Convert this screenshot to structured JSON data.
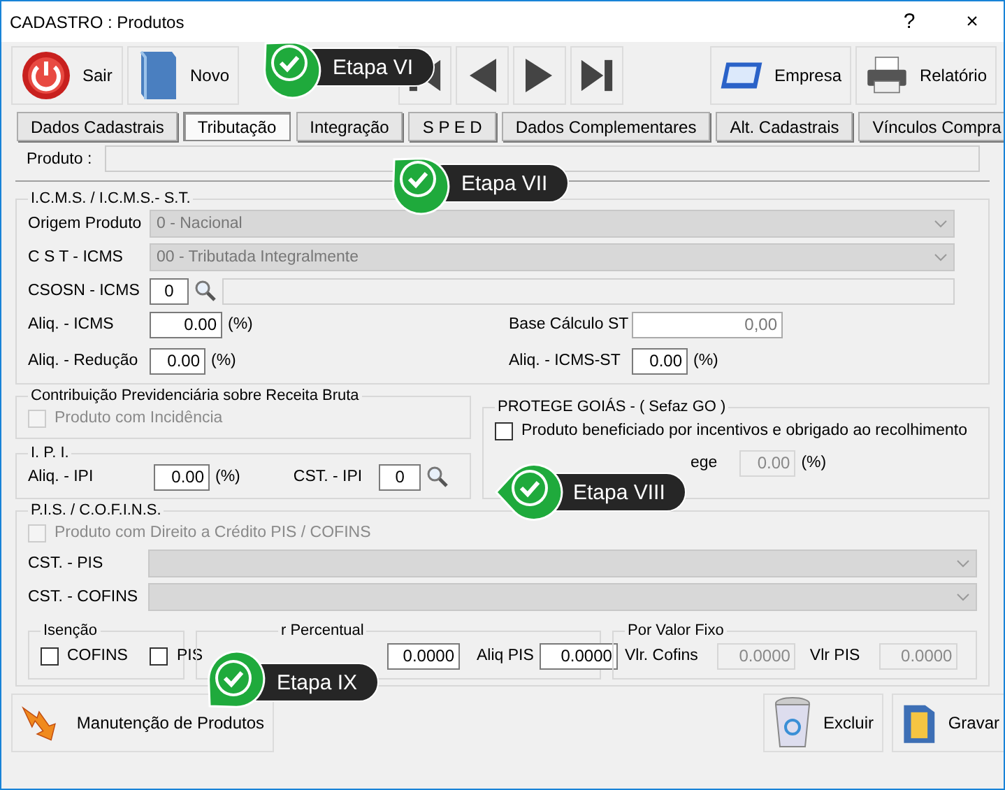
{
  "window": {
    "title": "CADASTRO : Produtos",
    "help": "?",
    "close": "×"
  },
  "toolbar": {
    "left": [
      {
        "kind": "exit",
        "label": "Sair"
      },
      {
        "kind": "new",
        "label": "Novo"
      }
    ],
    "nav": [
      {
        "kind": "first"
      },
      {
        "kind": "prev"
      },
      {
        "kind": "next"
      },
      {
        "kind": "last"
      }
    ],
    "right": [
      {
        "kind": "company",
        "label": "Empresa"
      },
      {
        "kind": "report",
        "label": "Relatório"
      }
    ]
  },
  "tabs": [
    {
      "label": "Dados Cadastrais",
      "selected": false
    },
    {
      "label": "Tributação",
      "selected": true
    },
    {
      "label": "Integração",
      "selected": false
    },
    {
      "label": "S P E D",
      "selected": false
    },
    {
      "label": "Dados Complementares",
      "selected": false
    },
    {
      "label": "Alt. Cadastrais",
      "selected": false
    },
    {
      "label": "Vínculos Compra",
      "selected": false
    }
  ],
  "produto": {
    "label": "Produto :"
  },
  "icms": {
    "title": "I.C.M.S. / I.C.M.S.- S.T.",
    "origem": {
      "label": "Origem Produto",
      "value": "0 - Nacional"
    },
    "cst": {
      "label": "C S T - ICMS",
      "value": "00 - Tributada Integralmente"
    },
    "csosn": {
      "label": "CSOSN - ICMS",
      "value": "0"
    },
    "aliq": {
      "label": "Aliq. - ICMS",
      "value": "0.00",
      "unit": "(%)"
    },
    "reducao": {
      "label": "Aliq. - Redução",
      "value": "0.00",
      "unit": "(%)"
    },
    "base_st": {
      "label": "Base Cálculo ST",
      "value": "0,00"
    },
    "aliq_st": {
      "label": "Aliq. - ICMS-ST",
      "value": "0.00",
      "unit": "(%)"
    }
  },
  "contribuicao": {
    "title": "Contribuição Previdenciária sobre Receita Bruta",
    "checkbox": {
      "label": "Produto com Incidência",
      "checked": false,
      "disabled": true
    }
  },
  "ipi": {
    "title": "I. P. I.",
    "aliq": {
      "label": "Aliq. - IPI",
      "value": "0.00",
      "unit": "(%)"
    },
    "cst": {
      "label": "CST. - IPI",
      "value": "0"
    }
  },
  "protege": {
    "title": "PROTEGE GOIÁS  - ( Sefaz GO )",
    "checkbox": {
      "label": "Produto beneficiado por incentivos e obrigado ao recolhimento",
      "checked": false,
      "disabled": false
    },
    "percent": {
      "label": "ege",
      "value": "0.00",
      "unit": "(%)"
    }
  },
  "pis_cofins": {
    "title": "P.I.S. / C.O.F.I.N.S.",
    "checkbox": {
      "label": "Produto com Direito a Crédito PIS / COFINS",
      "checked": false,
      "disabled": true
    },
    "cst_pis": {
      "label": "CST. - PIS"
    },
    "cst_cofins": {
      "label": "CST. - COFINS"
    },
    "isencao": {
      "title": "Isenção",
      "options": [
        {
          "label": "COFINS",
          "checked": false
        },
        {
          "label": "PIS",
          "checked": false
        }
      ]
    },
    "percentual": {
      "title": "r Percentual",
      "cofins_value": "0.0000",
      "pis": {
        "label": "Aliq PIS",
        "value": "0.0000"
      }
    },
    "fixo": {
      "title": "Por Valor Fixo",
      "cofins": {
        "label": "Vlr. Cofins",
        "value": "0.0000"
      },
      "pis": {
        "label": "Vlr PIS",
        "value": "0.0000"
      }
    }
  },
  "footer": {
    "left": {
      "kind": "maintenance",
      "label": "Manutenção de Produtos"
    },
    "right": [
      {
        "kind": "delete",
        "label": "Excluir"
      },
      {
        "kind": "save",
        "label": "Gravar"
      }
    ]
  },
  "callouts": [
    {
      "label": "Etapa VI"
    },
    {
      "label": "Etapa VII"
    },
    {
      "label": "Etapa VIII"
    },
    {
      "label": "Etapa IX"
    }
  ]
}
